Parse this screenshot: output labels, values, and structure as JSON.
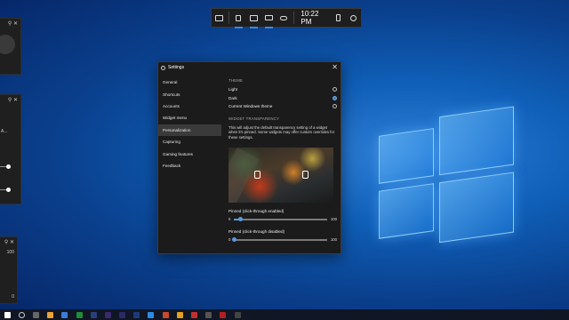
{
  "gamebar": {
    "time": "10:22 PM",
    "buttons": [
      "widget-menu-icon",
      "audio-icon",
      "capture-icon",
      "performance-icon",
      "xbox-social-icon"
    ]
  },
  "settings": {
    "title": "Settings",
    "close": "✕",
    "nav": [
      "General",
      "Shortcuts",
      "Accounts",
      "Widget menu",
      "Personalization",
      "Capturing",
      "Gaming features",
      "Feedback"
    ],
    "selected_nav": "Personalization",
    "theme": {
      "heading": "THEME",
      "options": [
        "Light",
        "Dark",
        "Current Windows theme"
      ],
      "selected": "Dark"
    },
    "transparency": {
      "heading": "WIDGET TRANSPARENCY",
      "description": "This will adjust the default transparency setting of a widget when it's pinned. Some widgets may offer custom overrides for these settings.",
      "pinned_enabled_label": "Pinned (click-through enabled)",
      "pinned_enabled_value": 0.07,
      "pinned_disabled_label": "Pinned (click-through disabled)",
      "pinned_disabled_value": 0.0,
      "min": "0",
      "max": "100"
    }
  },
  "left_widgets": {
    "w2_label": "A...",
    "w3_top": "100",
    "w3_bottom": "0"
  },
  "colors": {
    "accent": "#5a9be0",
    "window_bg": "#1b1b1b",
    "desktop": "#0f5fb8"
  }
}
